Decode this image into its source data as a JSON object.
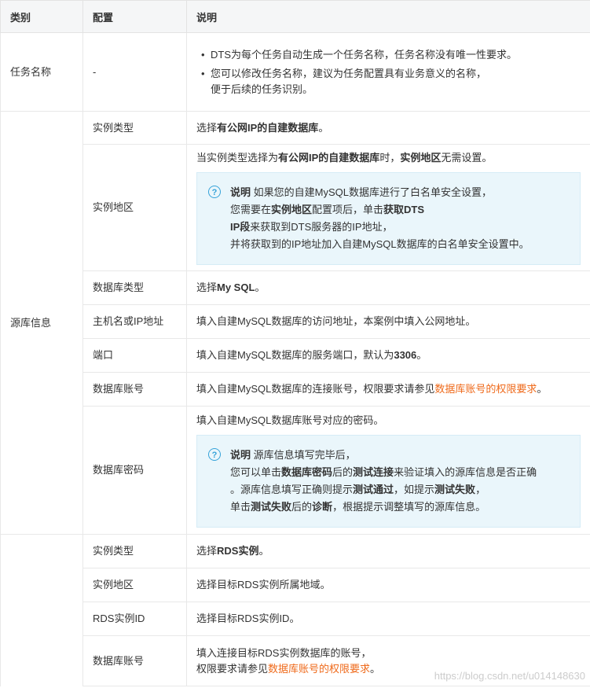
{
  "headers": [
    "类别",
    "配置",
    "说明"
  ],
  "task": {
    "category": "任务名称",
    "config": "-",
    "bullets": [
      "DTS为每个任务自动生成一个任务名称，任务名称没有唯一性要求。",
      "您可以修改任务名称，建议为任务配置具有业务意义的名称，",
      "便于后续的任务识别。"
    ]
  },
  "source": {
    "category": "源库信息",
    "instance_type": {
      "label": "实例类型",
      "pre": "选择",
      "bold": "有公网IP的自建数据库",
      "post": "。"
    },
    "region": {
      "label": "实例地区",
      "t1": "当实例类型选择为",
      "b1": "有公网IP的自建数据库",
      "t2": "时，",
      "b2": "实例地区",
      "t3": "无需设置。",
      "note_title": "说明",
      "n1": " 如果您的自建MySQL数据库进行了白名单安全设置，",
      "n2": "您需要在",
      "n3": "实例地区",
      "n4": "配置项后，单击",
      "n5": "获取DTS",
      "n6": "IP段",
      "n7": "来获取到DTS服务器的IP地址，",
      "n8": "并将获取到的IP地址加入自建MySQL数据库的白名单安全设置中。"
    },
    "db_type": {
      "label": "数据库类型",
      "pre": "选择",
      "bold": "My SQL",
      "post": "。"
    },
    "host": {
      "label": "主机名或IP地址",
      "text": "填入自建MySQL数据库的访问地址，本案例中填入公网地址。"
    },
    "port": {
      "label": "端口",
      "pre": "填入自建MySQL数据库的服务端口，默认为",
      "bold": "3306",
      "post": "。"
    },
    "account": {
      "label": "数据库账号",
      "pre": "填入自建MySQL数据库的连接账号，权限要求请参见",
      "link": "数据库账号的权限要求",
      "post": "。"
    },
    "password": {
      "label": "数据库密码",
      "text": "填入自建MySQL数据库账号对应的密码。",
      "note_title": "说明",
      "n1": " 源库信息填写完毕后，",
      "n2": "您可以单击",
      "n3": "数据库密码",
      "n4": "后的",
      "n5": "测试连接",
      "n6": "来验证填入的源库信息是否正确",
      "n7": "。源库信息填写正确则提示",
      "n8": "测试通过",
      "n9": "，如提示",
      "n10": "测试失败",
      "n11": "，",
      "n12": "单击",
      "n13": "测试失败",
      "n14": "后的",
      "n15": "诊断",
      "n16": "，根据提示调整填写的源库信息。"
    }
  },
  "target": {
    "instance_type": {
      "label": "实例类型",
      "pre": "选择",
      "bold": "RDS实例",
      "post": "。"
    },
    "region": {
      "label": "实例地区",
      "text": "选择目标RDS实例所属地域。"
    },
    "rds_id": {
      "label": "RDS实例ID",
      "text": "选择目标RDS实例ID。"
    },
    "account": {
      "label": "数据库账号",
      "t1": "填入连接目标RDS实例数据库的账号，",
      "t2": "权限要求请参见",
      "link": "数据库账号的权限要求",
      "post": "。"
    }
  },
  "watermark": "https://blog.csdn.net/u014148630"
}
